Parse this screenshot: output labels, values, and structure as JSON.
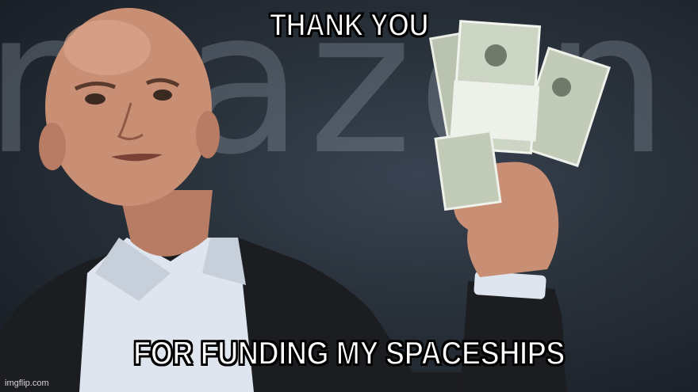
{
  "meme": {
    "top_text": "THANK YOU",
    "bottom_text": "FOR FUNDING MY SPACESHIPS",
    "background_text": "mazon",
    "watermark": "imgflip.com"
  },
  "colors": {
    "background": "#283039",
    "caption_fill": "#ffffff",
    "caption_outline": "#000000",
    "money": "#c9d1c0",
    "suit": "#1c1d21",
    "shirt": "#dfe5ee",
    "skin": "#c98f75"
  }
}
